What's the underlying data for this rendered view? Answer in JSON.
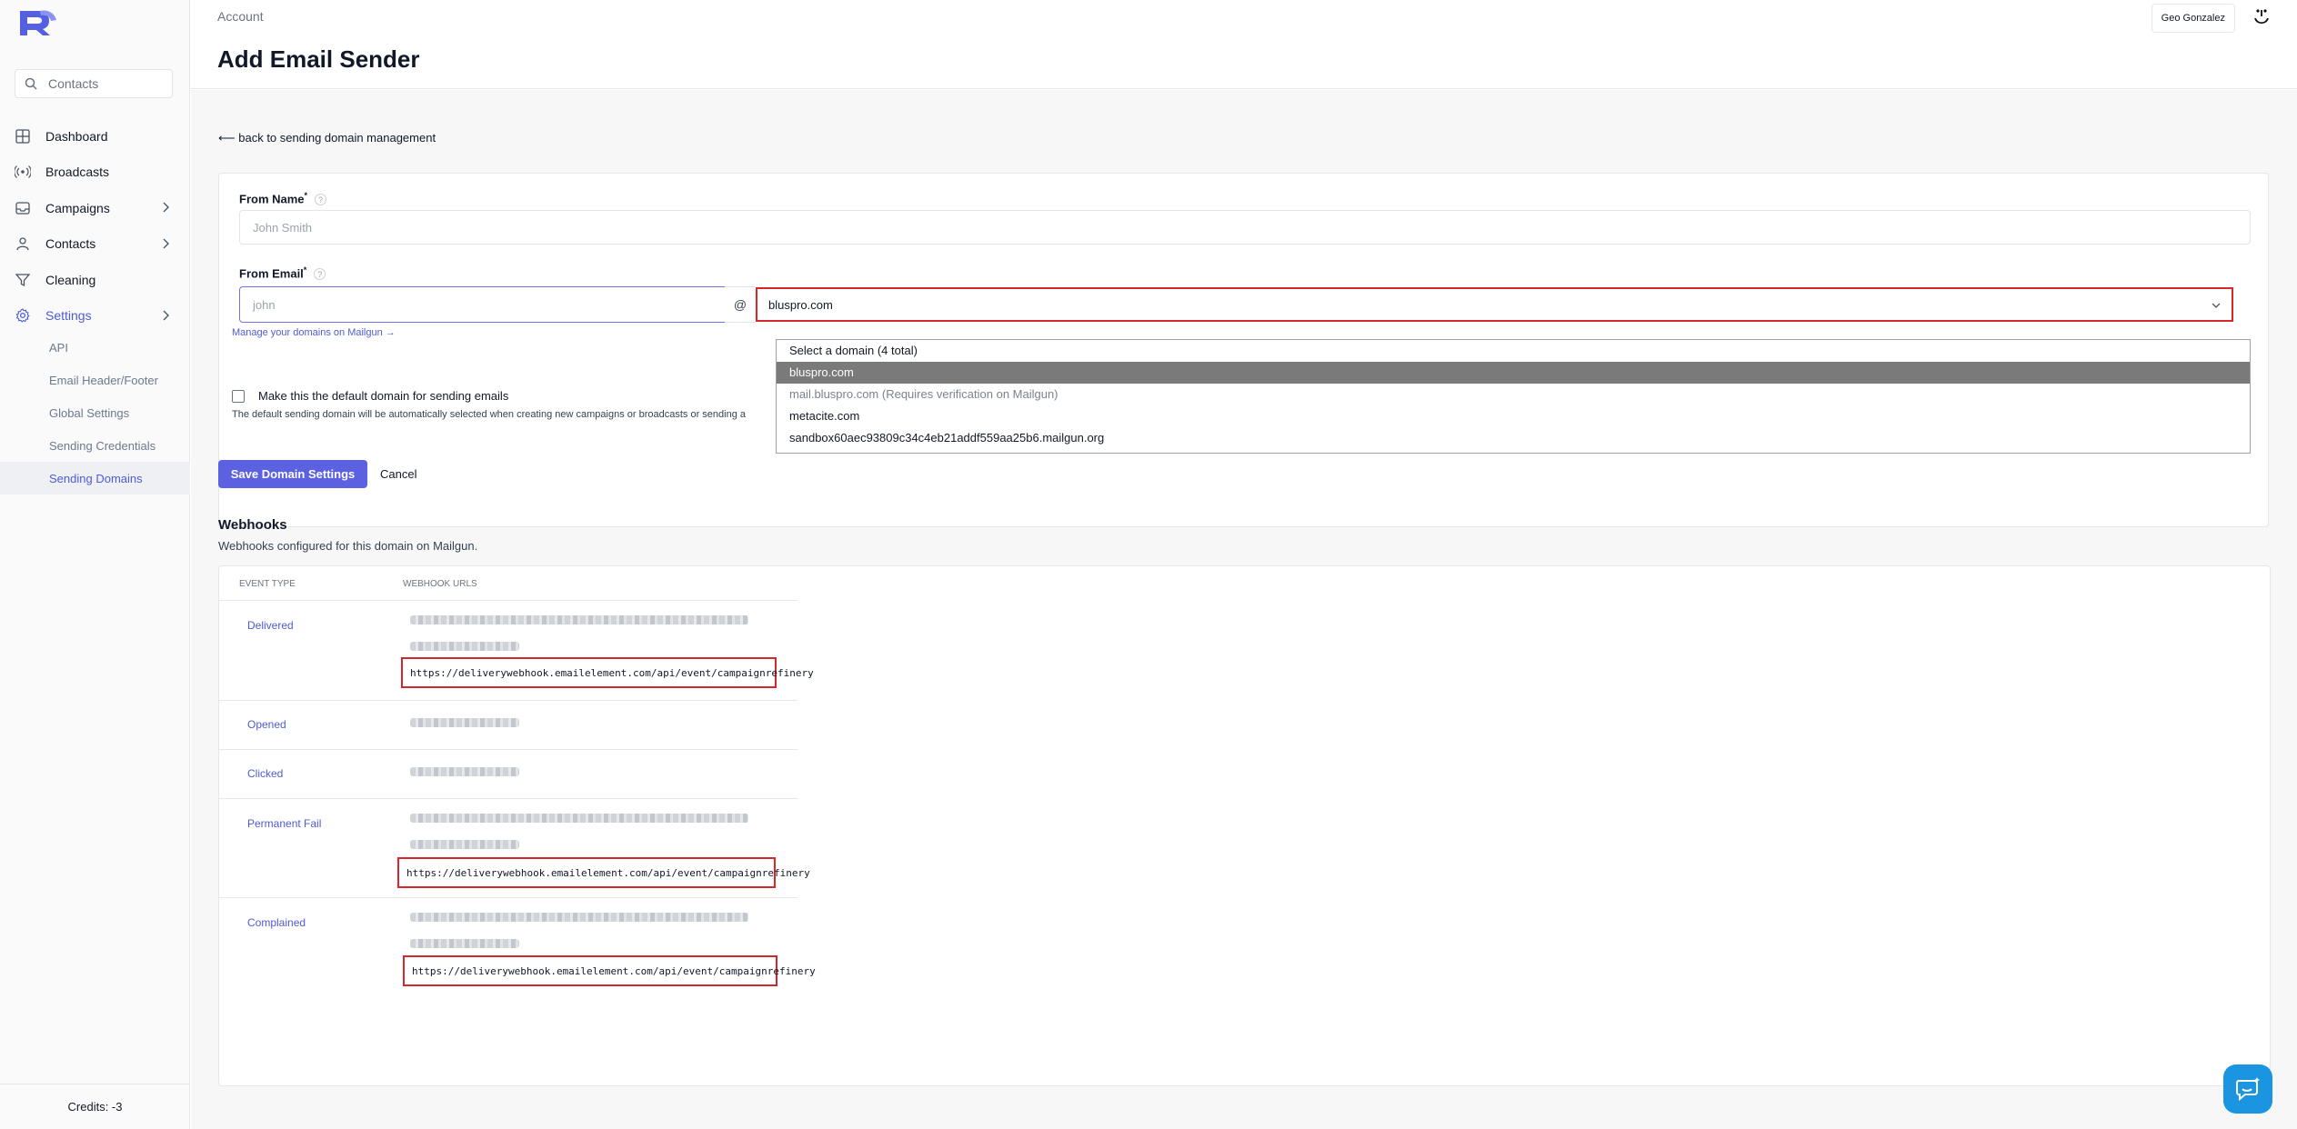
{
  "sidebar": {
    "search_placeholder": "Contacts",
    "items": [
      {
        "label": "Dashboard",
        "icon": "grid-icon"
      },
      {
        "label": "Broadcasts",
        "icon": "broadcast-icon"
      },
      {
        "label": "Campaigns",
        "icon": "inbox-icon"
      },
      {
        "label": "Contacts",
        "icon": "user-icon"
      },
      {
        "label": "Cleaning",
        "icon": "filter-icon"
      },
      {
        "label": "Settings",
        "icon": "gear-icon"
      }
    ],
    "sub_items": [
      {
        "label": "API"
      },
      {
        "label": "Email Header/Footer"
      },
      {
        "label": "Global Settings"
      },
      {
        "label": "Sending Credentials"
      },
      {
        "label": "Sending Domains"
      }
    ],
    "credits": "Credits: -3"
  },
  "header": {
    "breadcrumb": "Account",
    "title": "Add Email Sender",
    "user_name": "Geo Gonzalez"
  },
  "form": {
    "back_link": "⟵ back to sending domain management",
    "from_name_label": "From Name",
    "from_name_placeholder": "John Smith",
    "from_email_label": "From Email",
    "from_email_placeholder": "john",
    "at_symbol": "@",
    "domain_value": "bluspro.com",
    "manage_link": "Manage your domains on Mailgun →",
    "default_checkbox_label": "Make this the default domain for sending emails",
    "default_checkbox_help": "The default sending domain will be automatically selected when creating new campaigns or broadcasts or sending a",
    "required_mark": "*",
    "help_mark": "?",
    "dropdown_options": [
      {
        "label": "Select a domain (4 total)"
      },
      {
        "label": "bluspro.com"
      },
      {
        "label": "mail.bluspro.com (Requires verification on Mailgun)"
      },
      {
        "label": "metacite.com"
      },
      {
        "label": "sandbox60aec93809c34c4eb21addf559aa25b6.mailgun.org"
      }
    ],
    "save_button": "Save Domain Settings",
    "cancel_button": "Cancel"
  },
  "webhooks": {
    "title": "Webhooks",
    "subtitle": "Webhooks configured for this domain on Mailgun.",
    "col_event": "EVENT TYPE",
    "col_urls": "WEBHOOK URLS",
    "rows": [
      {
        "event": "Delivered",
        "url": "https://deliverywebhook.emailelement.com/api/event/campaignrefinery"
      },
      {
        "event": "Opened",
        "url": ""
      },
      {
        "event": "Clicked",
        "url": ""
      },
      {
        "event": "Permanent Fail",
        "url": "https://deliverywebhook.emailelement.com/api/event/campaignrefinery"
      },
      {
        "event": "Complained",
        "url": "https://deliverywebhook.emailelement.com/api/event/campaignrefinery"
      }
    ]
  },
  "colors": {
    "accent": "#5b61e0",
    "highlight_border": "#d62828",
    "chat_button": "#1b95e0"
  }
}
